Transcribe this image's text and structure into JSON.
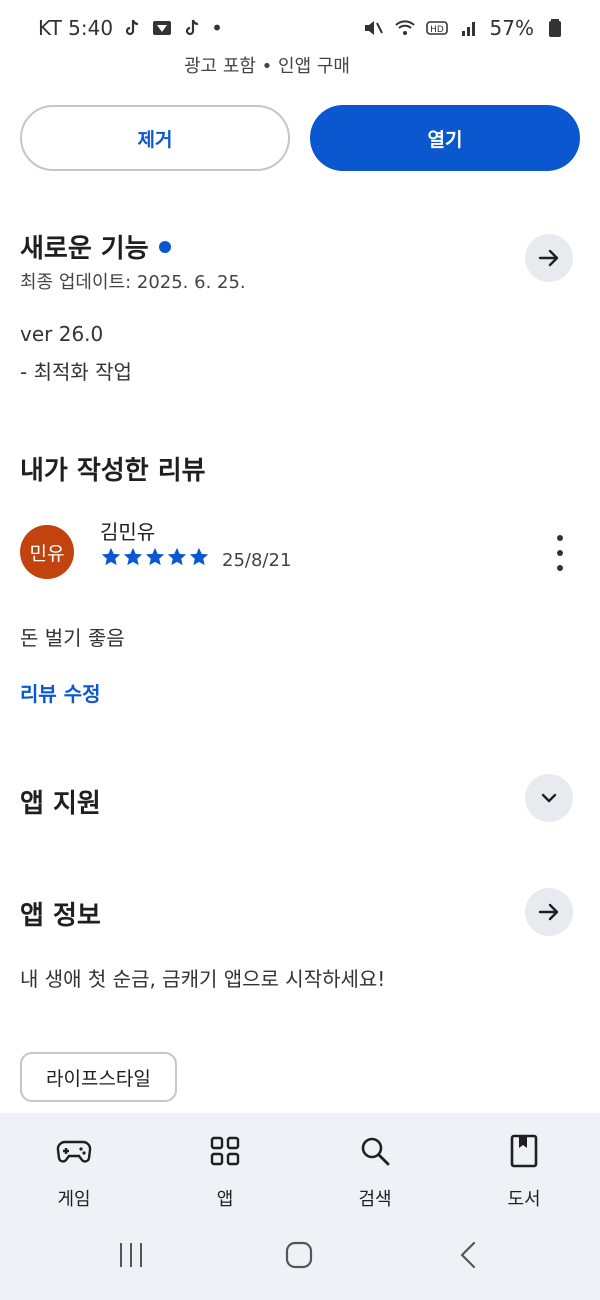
{
  "status_bar": {
    "carrier_time": "KT 5:40",
    "notif_dot": "•",
    "battery": "57%",
    "icons": [
      "tiktok-icon",
      "app-icon",
      "tiktok-icon",
      "mute-icon",
      "wifi-icon",
      "hd-icon",
      "signal-icon",
      "battery-icon"
    ]
  },
  "app": {
    "meta": "광고 포함 • 인앱 구매",
    "remove_label": "제거",
    "open_label": "열기"
  },
  "whats_new": {
    "title": "새로운 기능",
    "updated": "최종 업데이트: 2025. 6. 25.",
    "version": "ver 26.0",
    "note": "- 최적화 작업"
  },
  "my_review": {
    "title": "내가 작성한 리뷰",
    "avatar_text": "민유",
    "reviewer": "김민유",
    "rating": 5,
    "date": "25/8/21",
    "text": "돈 벌기 좋음",
    "edit_label": "리뷰 수정"
  },
  "app_support": {
    "title": "앱 지원"
  },
  "app_info": {
    "title": "앱 정보",
    "description": "내 생애 첫 순금, 금캐기 앱으로 시작하세요!",
    "category_chip": "라이프스타일"
  },
  "bottom_nav": {
    "items": [
      {
        "label": "게임",
        "icon": "gamepad-icon"
      },
      {
        "label": "앱",
        "icon": "apps-grid-icon"
      },
      {
        "label": "검색",
        "icon": "search-icon"
      },
      {
        "label": "도서",
        "icon": "book-icon"
      }
    ]
  },
  "colors": {
    "accent": "#0b57d0",
    "avatar": "#c1440e",
    "nav_bg": "#eef2f7"
  }
}
